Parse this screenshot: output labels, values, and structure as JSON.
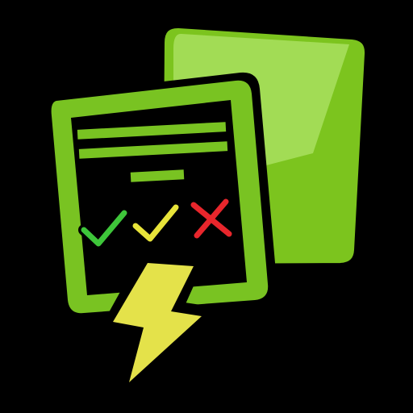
{
  "icon": {
    "name": "checklist-quiz-lightning-app-icon",
    "elements": {
      "back_card": "green-card",
      "document": "checklist-document",
      "text_lines": 3,
      "marks": [
        {
          "icon": "check-mark-icon",
          "color": "#3ec63a"
        },
        {
          "icon": "check-mark-icon",
          "color": "#e8e43a"
        },
        {
          "icon": "x-mark-icon",
          "color": "#e8262c"
        }
      ],
      "bolt": "lightning-bolt-icon"
    }
  },
  "colors": {
    "background": "#000000",
    "card_green": "#7cc41e",
    "card_highlight": "#a2dc55",
    "doc_green": "#79c322",
    "outline": "#000000",
    "bolt_yellow": "#e4e24a"
  }
}
